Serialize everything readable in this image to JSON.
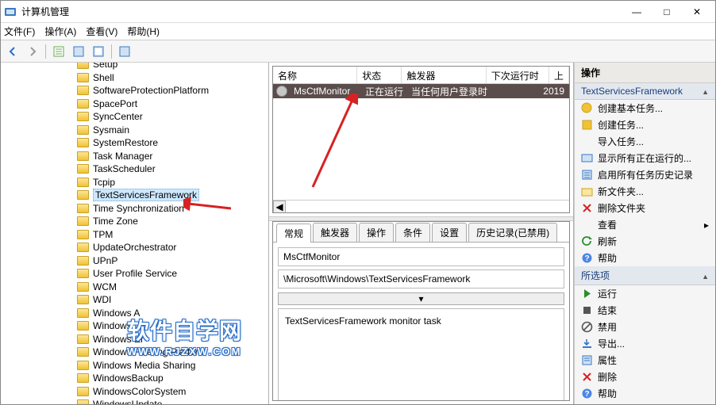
{
  "window": {
    "title": "计算机管理",
    "minimize": "—",
    "maximize": "□",
    "close": "✕"
  },
  "menu": {
    "file": "文件(F)",
    "action": "操作(A)",
    "view": "查看(V)",
    "help": "帮助(H)"
  },
  "tree": [
    "Setup",
    "Shell",
    "SoftwareProtectionPlatform",
    "SpacePort",
    "SyncCenter",
    "Sysmain",
    "SystemRestore",
    "Task Manager",
    "TaskScheduler",
    "Tcpip",
    "TextServicesFramework",
    "Time Synchronization",
    "Time Zone",
    "TPM",
    "UpdateOrchestrator",
    "UPnP",
    "User Profile Service",
    "WCM",
    "WDI",
    "Windows A",
    "Windows D",
    "Windows Er",
    "Windows Filtering Platform",
    "Windows Media Sharing",
    "WindowsBackup",
    "WindowsColorSystem",
    "WindowsUpdate"
  ],
  "tree_selected_index": 10,
  "list": {
    "columns": {
      "name": "名称",
      "status": "状态",
      "triggers": "触发器",
      "next_run": "下次运行时间",
      "last": "上次"
    },
    "row": {
      "name": "MsCtfMonitor",
      "status": "正在运行",
      "trigger": "当任何用户登录时",
      "next_run": "2019"
    }
  },
  "tabs": [
    "常规",
    "触发器",
    "操作",
    "条件",
    "设置",
    "历史记录(已禁用)"
  ],
  "detail": {
    "task_name": "MsCtfMonitor",
    "task_path": "\\Microsoft\\Windows\\TextServicesFramework",
    "description": "TextServicesFramework monitor task"
  },
  "actions": {
    "header": "操作",
    "section1": "TextServicesFramework",
    "items1": [
      "创建基本任务...",
      "创建任务...",
      "导入任务...",
      "显示所有正在运行的...",
      "启用所有任务历史记录",
      "新文件夹...",
      "删除文件夹",
      "查看",
      "刷新",
      "帮助"
    ],
    "section2": "所选项",
    "items2": [
      "运行",
      "结束",
      "禁用",
      "导出...",
      "属性",
      "删除",
      "帮助"
    ]
  },
  "icons": {
    "action_icons1": [
      "task-basic",
      "task",
      "",
      "tasks-running",
      "history",
      "folder-new",
      "folder-delete",
      "",
      "refresh",
      "help"
    ],
    "action_icons2": [
      "play",
      "stop",
      "disable",
      "export",
      "properties",
      "delete",
      "help"
    ]
  },
  "watermark_small": "www.rjzxw.com",
  "watermark_big_line1": "软件自学网",
  "watermark_big_line2": "WWW.RJZXW.COM"
}
